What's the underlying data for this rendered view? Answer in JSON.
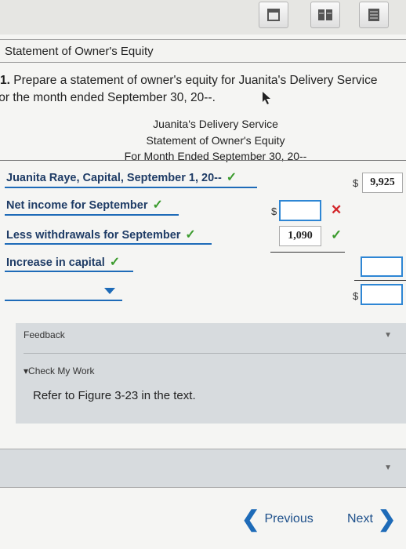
{
  "section": {
    "title": "Statement of Owner's Equity"
  },
  "question": {
    "number": "1.",
    "text_line1": "Prepare a statement of owner's equity for Juanita's Delivery Service",
    "text_line2": "for the month ended September 30, 20--."
  },
  "statement_header": {
    "company": "Juanita's Delivery Service",
    "statement": "Statement of Owner's Equity",
    "period": "For Month Ended September 30, 20--"
  },
  "rows": {
    "capital_label": "Juanita Raye, Capital, September 1, 20--",
    "capital_value": "9,925",
    "net_income_label": "Net income for September",
    "withdrawals_label": "Less withdrawals for September",
    "withdrawals_value": "1,090",
    "increase_label": "Increase in capital"
  },
  "symbols": {
    "dollar": "$",
    "check": "✓",
    "x": "✕"
  },
  "feedback": {
    "title": "Feedback",
    "check_my_work": "Check My Work",
    "hint": "Refer to Figure 3-23 in the text."
  },
  "nav": {
    "previous": "Previous",
    "next": "Next"
  },
  "colors": {
    "check_green": "#3b9b2d",
    "error_red": "#d3262a",
    "label_blue": "#1f3c66",
    "input_border": "#2e86d4"
  },
  "icons": [
    "single-page-view-icon",
    "two-page-view-icon",
    "list-view-icon",
    "chevron-left-icon",
    "chevron-right-icon",
    "dropdown-triangle-icon"
  ]
}
